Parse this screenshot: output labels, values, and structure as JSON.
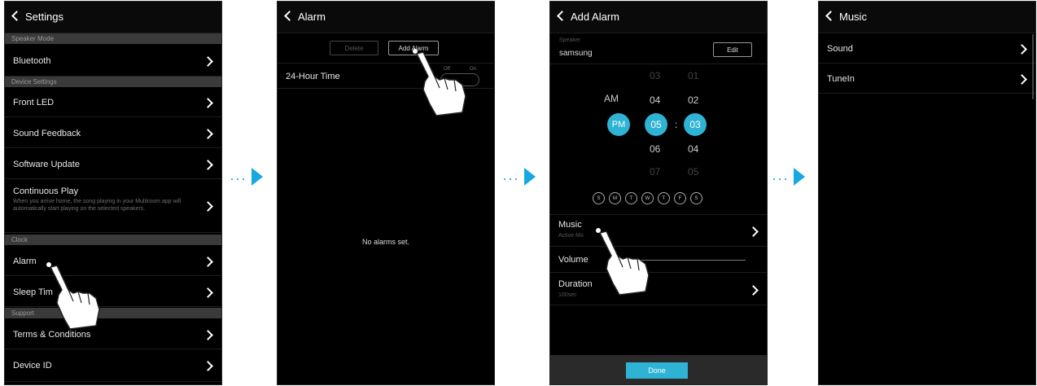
{
  "colors": {
    "accent": "#2fb3d4",
    "arrow": "#18a8e0",
    "background": "#000000",
    "section": "#3a3a3a"
  },
  "screen1": {
    "title": "Settings",
    "sections": {
      "speaker_mode": "Speaker Mode",
      "device_settings": "Device Settings",
      "clock": "Clock",
      "support": "Support"
    },
    "items": {
      "bluetooth": "Bluetooth",
      "front_led": "Front LED",
      "sound_feedback": "Sound Feedback",
      "software_update": "Software Update",
      "continuous_play": "Continuous Play",
      "continuous_play_desc": "When you arrive home, the song playing in your Multiroom app will automatically start playing on the selected speakers.",
      "alarm": "Alarm",
      "sleep_timer": "Sleep Tim",
      "terms": "Terms & Conditions",
      "device_id": "Device ID"
    }
  },
  "screen2": {
    "title": "Alarm",
    "delete_label": "Delete",
    "add_alarm_label": "Add Alarm",
    "hour_24_label": "24-Hour Time",
    "toggle_off": "Off",
    "toggle_on": "On",
    "empty_message": "No alarms set."
  },
  "screen3": {
    "title": "Add Alarm",
    "speaker_label": "Speaker",
    "speaker_value": "samsung",
    "edit_label": "Edit",
    "ampm": {
      "am": "AM",
      "pm": "PM"
    },
    "hours": [
      "03",
      "04",
      "05",
      "06",
      "07"
    ],
    "minutes": [
      "01",
      "02",
      "03",
      "04",
      "05"
    ],
    "colon": ":",
    "days": [
      "S",
      "M",
      "T",
      "W",
      "T",
      "F",
      "S"
    ],
    "music_label": "Music",
    "music_value": "Active Mo",
    "volume_label": "Volume",
    "duration_label": "Duration",
    "duration_value": "100sec",
    "done_label": "Done"
  },
  "screen4": {
    "title": "Music",
    "items": {
      "sound": "Sound",
      "tunein": "TuneIn"
    }
  }
}
